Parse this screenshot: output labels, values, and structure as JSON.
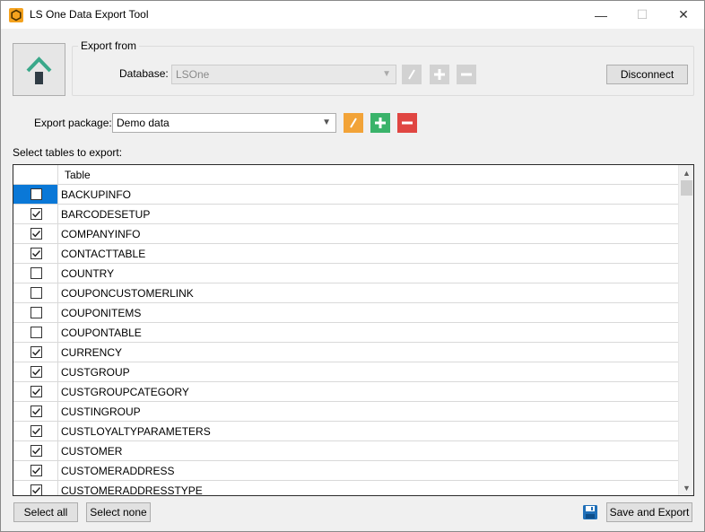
{
  "window": {
    "title": "LS One Data Export Tool",
    "minimize": "—",
    "maximize": "☐",
    "close": "✕"
  },
  "export_from": {
    "legend": "Export from",
    "database_label": "Database:",
    "database_value": "LSOne",
    "disconnect_label": "Disconnect"
  },
  "export_package": {
    "label": "Export package:",
    "value": "Demo data"
  },
  "tables": {
    "select_label": "Select tables to export:",
    "column_header": "Table",
    "rows": [
      {
        "name": "BACKUPINFO",
        "checked": false,
        "selected": true
      },
      {
        "name": "BARCODESETUP",
        "checked": true,
        "selected": false
      },
      {
        "name": "COMPANYINFO",
        "checked": true,
        "selected": false
      },
      {
        "name": "CONTACTTABLE",
        "checked": true,
        "selected": false
      },
      {
        "name": "COUNTRY",
        "checked": false,
        "selected": false
      },
      {
        "name": "COUPONCUSTOMERLINK",
        "checked": false,
        "selected": false
      },
      {
        "name": "COUPONITEMS",
        "checked": false,
        "selected": false
      },
      {
        "name": "COUPONTABLE",
        "checked": false,
        "selected": false
      },
      {
        "name": "CURRENCY",
        "checked": true,
        "selected": false
      },
      {
        "name": "CUSTGROUP",
        "checked": true,
        "selected": false
      },
      {
        "name": "CUSTGROUPCATEGORY",
        "checked": true,
        "selected": false
      },
      {
        "name": "CUSTINGROUP",
        "checked": true,
        "selected": false
      },
      {
        "name": "CUSTLOYALTYPARAMETERS",
        "checked": true,
        "selected": false
      },
      {
        "name": "CUSTOMER",
        "checked": true,
        "selected": false
      },
      {
        "name": "CUSTOMERADDRESS",
        "checked": true,
        "selected": false
      },
      {
        "name": "CUSTOMERADDRESSTYPE",
        "checked": true,
        "selected": false
      }
    ]
  },
  "footer": {
    "select_all_label": "Select all",
    "select_none_label": "Select none",
    "save_and_export_label": "Save and Export"
  },
  "colors": {
    "accent_selected": "#0a78d7",
    "edit_orange": "#f2a338",
    "add_green": "#3ab36a",
    "remove_red": "#e04642",
    "app_icon": "#f4a21e",
    "home_icon": "#3aa88a"
  },
  "icons": {
    "app": "ls-one-logo-icon",
    "home": "home-icon",
    "edit": "pencil-icon",
    "add": "plus-icon",
    "remove": "minus-icon",
    "save": "floppy-disk-icon"
  }
}
